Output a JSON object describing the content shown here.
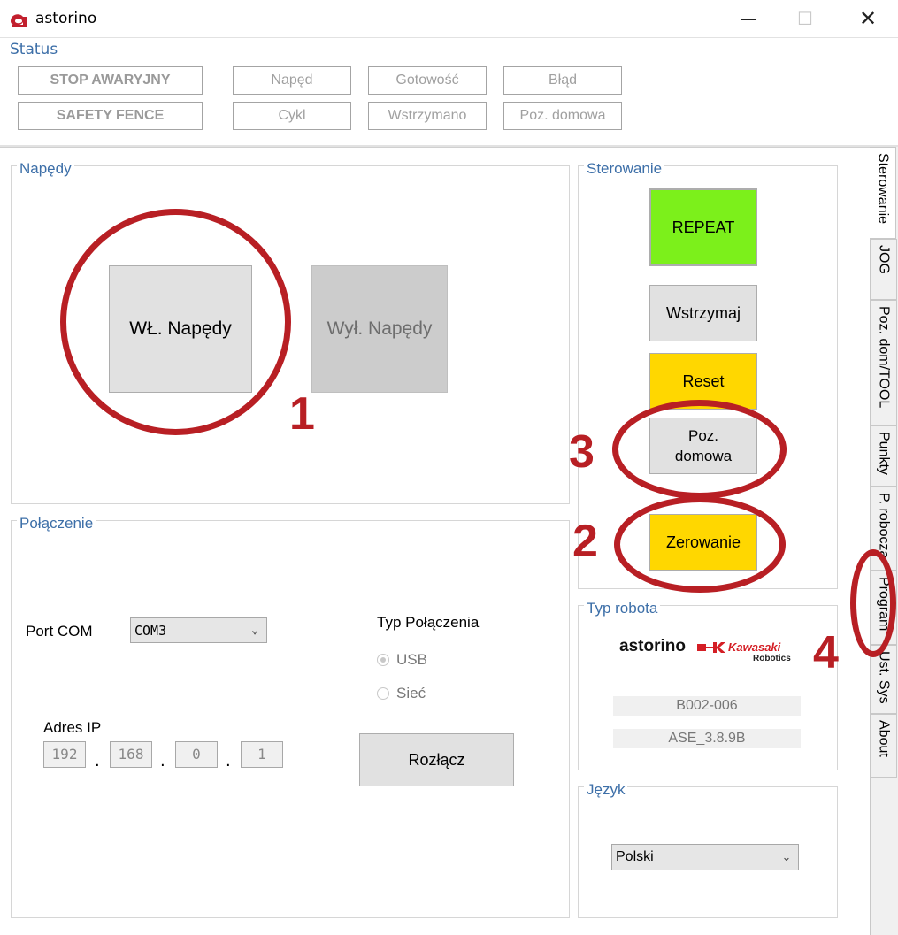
{
  "window": {
    "title": "astorino",
    "controls": {
      "minimize": "—",
      "maximize": "☐",
      "close": "✕"
    }
  },
  "status": {
    "legend": "Status",
    "buttons_left": [
      "STOP AWARYJNY",
      "SAFETY FENCE"
    ],
    "indicators": [
      "Napęd",
      "Gotowość",
      "Błąd",
      "Cykl",
      "Wstrzymano",
      "Poz. domowa"
    ]
  },
  "drives": {
    "legend": "Napędy",
    "on_label": "WŁ. Napędy",
    "off_label": "Wył. Napędy"
  },
  "connection": {
    "legend": "Połączenie",
    "port_label": "Port COM",
    "port_value": "COM3",
    "type_label": "Typ Połączenia",
    "type_options": [
      "USB",
      "Sieć"
    ],
    "type_selected": "USB",
    "ip_label": "Adres IP",
    "ip": [
      "192",
      "168",
      "0",
      "1"
    ],
    "disconnect_label": "Rozłącz"
  },
  "control": {
    "legend": "Sterowanie",
    "repeat_label": "REPEAT",
    "hold_label": "Wstrzymaj",
    "reset_label": "Reset",
    "home_label": "Poz. domowa",
    "zero_label": "Zerowanie",
    "colors": {
      "repeat": "#7cf01b",
      "reset": "#ffd700",
      "zero": "#ffd700"
    }
  },
  "robot_type": {
    "legend": "Typ robota",
    "brand": "astorino",
    "maker": "Kawasaki",
    "maker_sub": "Robotics",
    "model": "B002-006",
    "version": "ASE_3.8.9B"
  },
  "language": {
    "legend": "Język",
    "value": "Polski"
  },
  "tabs": [
    "Sterowanie",
    "JOG",
    "Poz. dom/TOOL",
    "Punkty",
    "P. robocza",
    "Program",
    "Ust. Sys",
    "About"
  ],
  "active_tab": "Sterowanie",
  "annotations": {
    "numbers": [
      "1",
      "2",
      "3",
      "4"
    ],
    "color": "#b81f24"
  }
}
